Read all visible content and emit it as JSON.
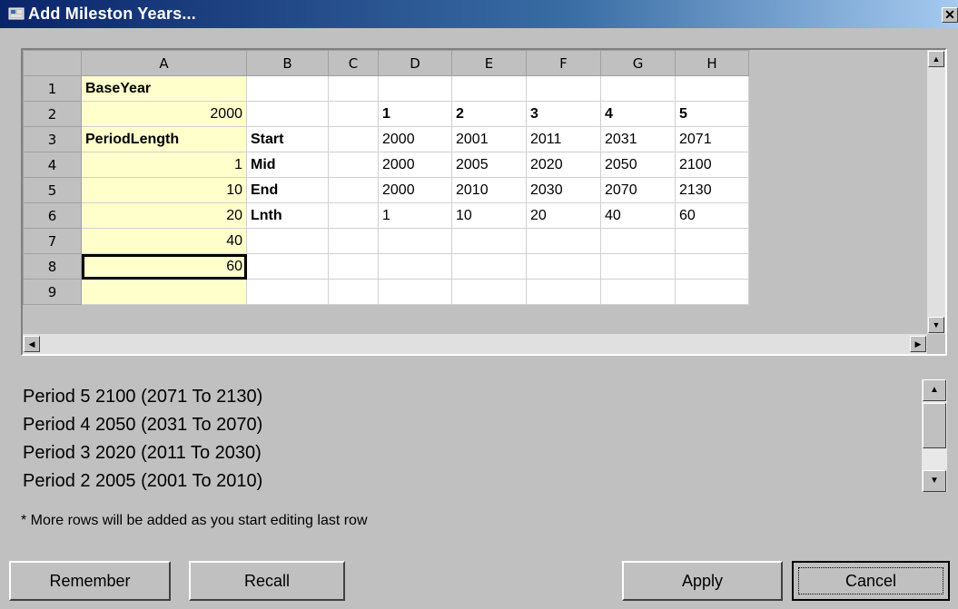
{
  "window": {
    "title": "Add Mileston Years...",
    "close_glyph": "✕"
  },
  "grid": {
    "columns": [
      "A",
      "B",
      "C",
      "D",
      "E",
      "F",
      "G",
      "H"
    ],
    "rows": [
      {
        "num": "1",
        "cells": [
          "BaseYear",
          "",
          "",
          "",
          "",
          "",
          "",
          ""
        ]
      },
      {
        "num": "2",
        "cells": [
          "2000",
          "",
          "",
          "1",
          "2",
          "3",
          "4",
          "5"
        ]
      },
      {
        "num": "3",
        "cells": [
          "PeriodLength",
          "Start",
          "",
          "2000",
          "2001",
          "2011",
          "2031",
          "2071"
        ]
      },
      {
        "num": "4",
        "cells": [
          "1",
          "Mid",
          "",
          "2000",
          "2005",
          "2020",
          "2050",
          "2100"
        ]
      },
      {
        "num": "5",
        "cells": [
          "10",
          "End",
          "",
          "2000",
          "2010",
          "2030",
          "2070",
          "2130"
        ]
      },
      {
        "num": "6",
        "cells": [
          "20",
          "Lnth",
          "",
          "1",
          "10",
          "20",
          "40",
          "60"
        ]
      },
      {
        "num": "7",
        "cells": [
          "40",
          "",
          "",
          "",
          "",
          "",
          "",
          ""
        ]
      },
      {
        "num": "8",
        "cells": [
          "60",
          "",
          "",
          "",
          "",
          "",
          "",
          ""
        ]
      },
      {
        "num": "9",
        "cells": [
          "",
          "",
          "",
          "",
          "",
          "",
          "",
          ""
        ]
      }
    ],
    "selected_cell": "A8"
  },
  "periods": [
    "Period 5 2100 (2071 To 2130)",
    "Period 4 2050 (2031 To 2070)",
    "Period 3 2020 (2011 To 2030)",
    "Period 2 2005 (2001 To 2010)"
  ],
  "note": "* More rows will be added as you start editing last row",
  "buttons": {
    "remember": "Remember",
    "recall": "Recall",
    "apply": "Apply",
    "cancel": "Cancel"
  },
  "icons": {
    "up": "▲",
    "down": "▼",
    "left": "◀",
    "right": "▶"
  }
}
